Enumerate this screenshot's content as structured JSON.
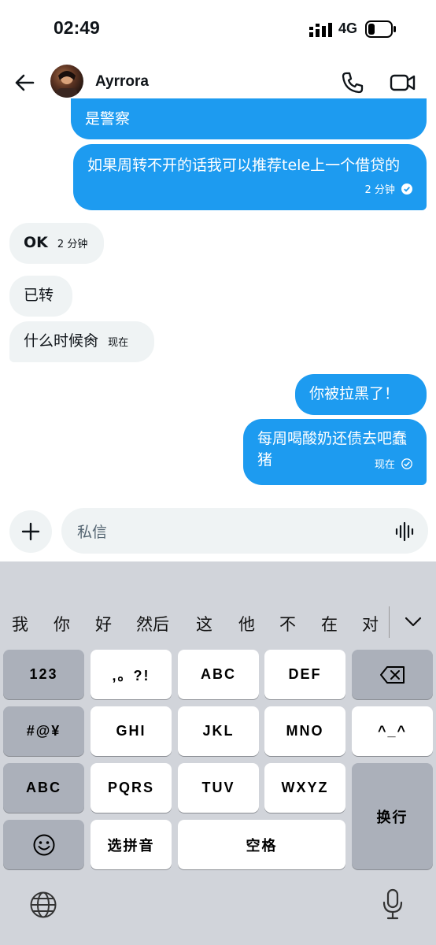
{
  "status_bar": {
    "time": "02:49",
    "network": "4G"
  },
  "header": {
    "contact_name": "Ayrrora"
  },
  "messages": [
    {
      "dir": "out",
      "text": "是警察",
      "meta": ""
    },
    {
      "dir": "out",
      "text": "如果周转不开的话我可以推荐tele上一个借贷的",
      "meta": "2 分钟"
    },
    {
      "dir": "in",
      "text": "OK",
      "meta": "2 分钟"
    },
    {
      "dir": "in",
      "text": "已转",
      "meta": ""
    },
    {
      "dir": "in",
      "text": "什么时候肏",
      "meta": "现在"
    },
    {
      "dir": "out",
      "text": "你被拉黑了！",
      "meta": ""
    },
    {
      "dir": "out",
      "text": "每周喝酸奶还债去吧蠢猪",
      "meta": "现在"
    }
  ],
  "composer": {
    "placeholder": "私信"
  },
  "keyboard": {
    "candidates": [
      "我",
      "你",
      "好",
      "然后",
      "这",
      "他",
      "不",
      "在",
      "对"
    ],
    "keys": {
      "k123": "123",
      "punct": ",。?!",
      "abc": "ABC",
      "def": "DEF",
      "sym": "#@¥",
      "ghi": "GHI",
      "jkl": "JKL",
      "mno": "MNO",
      "emoticon": "^_^",
      "abc_mode": "ABC",
      "pqrs": "PQRS",
      "tuv": "TUV",
      "wxyz": "WXYZ",
      "enter": "换行",
      "pinyin": "选拼音",
      "space": "空格"
    }
  },
  "colors": {
    "accent": "#1d9bf0",
    "incoming_bubble": "#eff3f4",
    "keyboard_bg": "#d1d4da"
  }
}
